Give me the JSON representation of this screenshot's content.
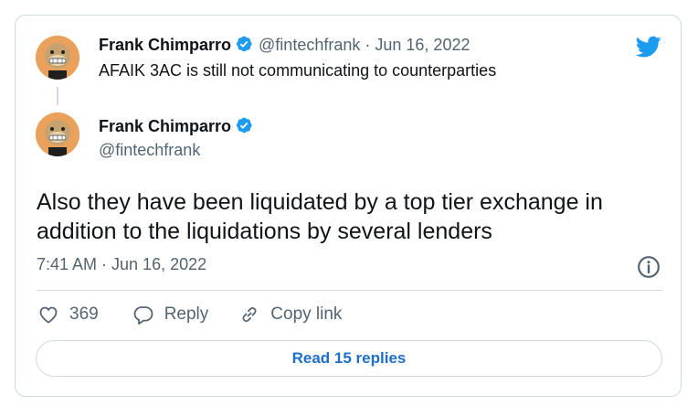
{
  "quoted_tweet": {
    "author_name": "Frank Chimparro",
    "handle": "@fintechfrank",
    "separator": "·",
    "date": "Jun 16, 2022",
    "text": "AFAIK 3AC is still not communicating to counterparties"
  },
  "main_tweet": {
    "author_name": "Frank Chimparro",
    "handle": "@fintechfrank",
    "text": "Also they have been liquidated by a top tier exchange in addition to the liquidations by several lenders",
    "timestamp": "7:41 AM · Jun 16, 2022"
  },
  "actions": {
    "like_count": "369",
    "reply_label": "Reply",
    "copy_link_label": "Copy link"
  },
  "read_replies_label": "Read 15 replies",
  "colors": {
    "brand_blue": "#1d9bf0",
    "link_blue": "#1d6fc9",
    "muted_text": "#536471",
    "border": "#cfd9de"
  },
  "icons": [
    "twitter-bird-icon",
    "verified-badge-icon",
    "info-icon",
    "heart-icon",
    "reply-bubble-icon",
    "link-icon"
  ]
}
